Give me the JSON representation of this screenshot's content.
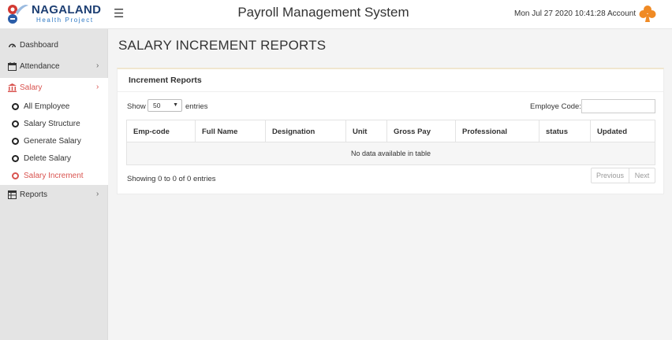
{
  "header": {
    "logo_title": "NAGALAND",
    "logo_subtitle": "Health Project",
    "app_title": "Payroll Management System",
    "datetime": "Mon Jul 27 2020 10:41:28",
    "account_label": "Account",
    "menu_icon": "hamburger-icon",
    "account_icon": "club-icon"
  },
  "sidebar": {
    "items": [
      {
        "label": "Dashboard",
        "icon": "dashboard-icon"
      },
      {
        "label": "Attendance",
        "icon": "calendar-icon"
      },
      {
        "label": "Salary",
        "icon": "bank-icon"
      },
      {
        "label": "Reports",
        "icon": "table-icon"
      }
    ],
    "salary_subitems": [
      {
        "label": "All Employee"
      },
      {
        "label": "Salary Structure"
      },
      {
        "label": "Generate Salary"
      },
      {
        "label": "Delete Salary"
      },
      {
        "label": "Salary Increment"
      }
    ]
  },
  "main": {
    "page_title": "SALARY INCREMENT REPORTS",
    "card_title": "Increment Reports",
    "show_label": "Show",
    "length_value": "50",
    "entries_label": "entries",
    "employee_code_label": "Employe Code:",
    "columns": [
      "Emp-code",
      "Full Name",
      "Designation",
      "Unit",
      "Gross Pay",
      "Professional",
      "status",
      "Updated"
    ],
    "empty_message": "No data available in table",
    "info": "Showing 0 to 0 of 0 entries",
    "prev_label": "Previous",
    "next_label": "Next"
  },
  "colors": {
    "accent": "#d9534f",
    "logo_blue": "#1d3f73",
    "account_orange": "#f08a24"
  }
}
